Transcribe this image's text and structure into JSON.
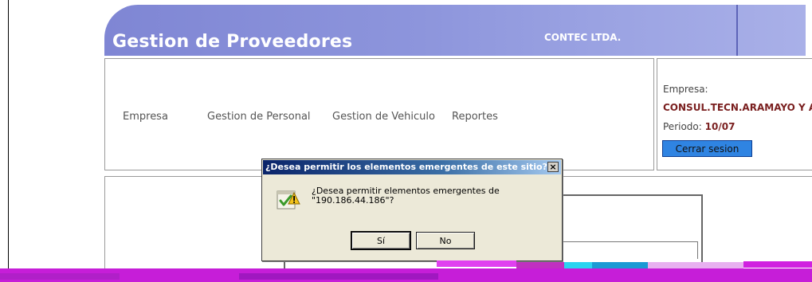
{
  "app": {
    "title": "Gestion de Proveedores",
    "company_header": "CONTEC LTDA."
  },
  "nav": {
    "items": [
      {
        "label": "Empresa"
      },
      {
        "label": "Gestion de Personal"
      },
      {
        "label": "Gestion de Vehiculo"
      },
      {
        "label": "Reportes"
      }
    ]
  },
  "info": {
    "empresa_label": "Empresa:",
    "empresa_value": "CONSUL.TECN.ARAMAYO Y AS",
    "periodo_label": "Periodo:",
    "periodo_value": "10/07",
    "logout_label": "Cerrar sesion"
  },
  "dialog": {
    "title": "¿Desea permitir los elementos emergentes de este sitio?",
    "close_glyph": "×",
    "message_line1": "¿Desea permitir elementos emergentes de",
    "message_line2": "\"190.186.44.186\"?",
    "yes_label": "Sí",
    "no_label": "No",
    "icon": "warning-check-icon"
  },
  "colors": {
    "header": "#8d95dc",
    "company_text": "#7a1f1f",
    "logout_button": "#2f84e2",
    "dialog_title": "#0a246a"
  }
}
